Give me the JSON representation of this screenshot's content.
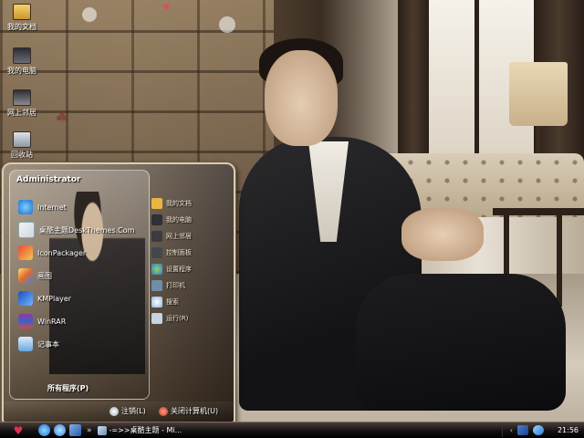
{
  "desktop": {
    "icons": [
      {
        "label": "我的文档",
        "icon": "documents-folder-icon"
      },
      {
        "label": "我的电脑",
        "icon": "computer-icon"
      },
      {
        "label": "网上邻居",
        "icon": "network-icon"
      },
      {
        "label": "回收站",
        "icon": "recycle-bin-icon"
      }
    ]
  },
  "start_menu": {
    "user_name": "Administrator",
    "programs": [
      {
        "label": "Internet",
        "icon": "internet-explorer-icon"
      },
      {
        "label": "桌酷主题DeskThemes.Com",
        "icon": "theme-icon"
      },
      {
        "label": "IconPackager",
        "icon": "iconpackager-icon"
      },
      {
        "label": "画图",
        "icon": "paint-icon"
      },
      {
        "label": "KMPlayer",
        "icon": "kmplayer-icon"
      },
      {
        "label": "WinRAR",
        "icon": "winrar-icon"
      },
      {
        "label": "记事本",
        "icon": "notepad-icon"
      }
    ],
    "all_programs": "所有程序(P)",
    "right_items": [
      {
        "label": "我的文档",
        "icon": "folder-icon"
      },
      {
        "label": "我的电脑",
        "icon": "computer-icon"
      },
      {
        "label": "网上邻居",
        "icon": "network-icon"
      },
      {
        "label": "控制面板",
        "icon": "control-panel-icon"
      },
      {
        "label": "设置程序",
        "icon": "programs-icon"
      },
      {
        "label": "打印机",
        "icon": "printer-icon"
      },
      {
        "label": "搜索",
        "icon": "search-icon"
      },
      {
        "label": "运行(R)",
        "icon": "run-icon"
      }
    ],
    "logoff_label": "注销(L)",
    "shutdown_label": "关闭计算机(U)"
  },
  "taskbar": {
    "start_icon": "heart-start-icon",
    "quick_launch": [
      "internet-explorer-icon",
      "ie-secondary-icon",
      "show-desktop-icon"
    ],
    "chevron": "»",
    "task_label": "-=>>桌酷主题 - Mi...",
    "clock": "21:56"
  },
  "colors": {
    "taskbar": "#141012",
    "accent": "#e03050",
    "menu_border": "#d8cdb5"
  }
}
